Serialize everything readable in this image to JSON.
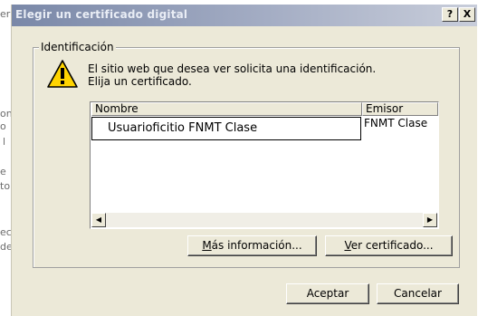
{
  "background_fragments": [
    "er",
    "on",
    "o",
    "l",
    "e",
    "to",
    "ec",
    "de"
  ],
  "dialog": {
    "title": "Elegir un certificado digital",
    "help_button": "?",
    "close_button": "X",
    "group_label": "Identificación",
    "icon": "warning-icon",
    "message_line1": "El sitio web que desea ver solicita una identificación.",
    "message_line2": "Elija un certificado.",
    "table": {
      "columns": [
        "Nombre",
        "Emisor"
      ],
      "rows": [
        {
          "nombre": "Usuarioficitio FNMT Clase",
          "emisor": "FNMT Clase"
        }
      ]
    },
    "more_info": {
      "accel": "M",
      "rest": "ás información..."
    },
    "view_cert": {
      "accel": "V",
      "rest": "er certificado..."
    },
    "accept_label": "Aceptar",
    "cancel_label": "Cancelar"
  }
}
